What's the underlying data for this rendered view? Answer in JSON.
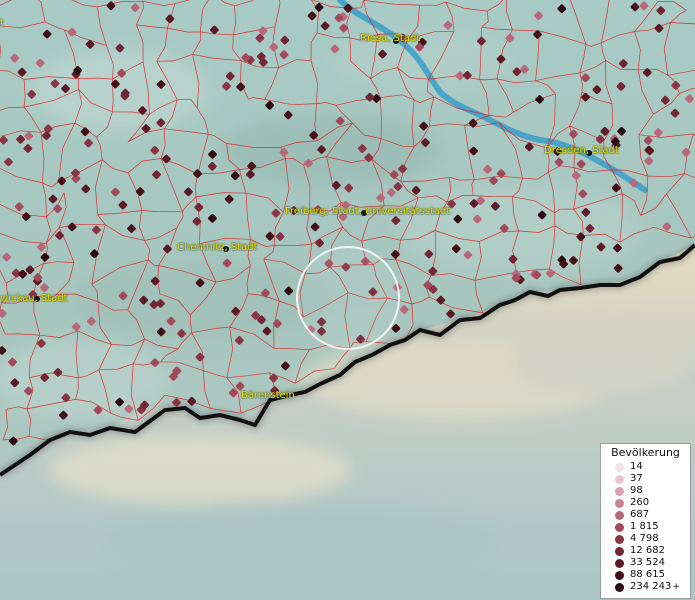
{
  "map": {
    "cities": [
      {
        "name": "Riesa, Stadt",
        "id": "riesa"
      },
      {
        "name": "Dresden, Stadt",
        "id": "dresden"
      },
      {
        "name": "Freiberg, Stadt, Universitätsstadt",
        "id": "freiberg"
      },
      {
        "name": "Chemnitz, Stadt",
        "id": "chemnitz"
      },
      {
        "name": "wickau, Stadt",
        "id": "zwickau"
      },
      {
        "name": "Bärenstein",
        "id": "baerenstein"
      },
      {
        "name": "t",
        "id": "edge-top-left"
      }
    ]
  },
  "legend": {
    "title": "Bevölkerung",
    "entries": [
      {
        "value": "14",
        "color": "#f6dfe6"
      },
      {
        "value": "37",
        "color": "#eac2cd"
      },
      {
        "value": "98",
        "color": "#d9a0b0"
      },
      {
        "value": "260",
        "color": "#c98494"
      },
      {
        "value": "687",
        "color": "#b8687a"
      },
      {
        "value": "1 815",
        "color": "#a24a5c"
      },
      {
        "value": "4 798",
        "color": "#8a3444"
      },
      {
        "value": "12 682",
        "color": "#742636"
      },
      {
        "value": "33 524",
        "color": "#5c1a28"
      },
      {
        "value": "88 615",
        "color": "#43101a"
      },
      {
        "value": "234 243",
        "color": "#2a0810",
        "plus": "+"
      }
    ]
  },
  "colors": {
    "boundary": "#e02020",
    "river": "#3a9ec8",
    "border": "#111111",
    "label": "#e8e000"
  }
}
